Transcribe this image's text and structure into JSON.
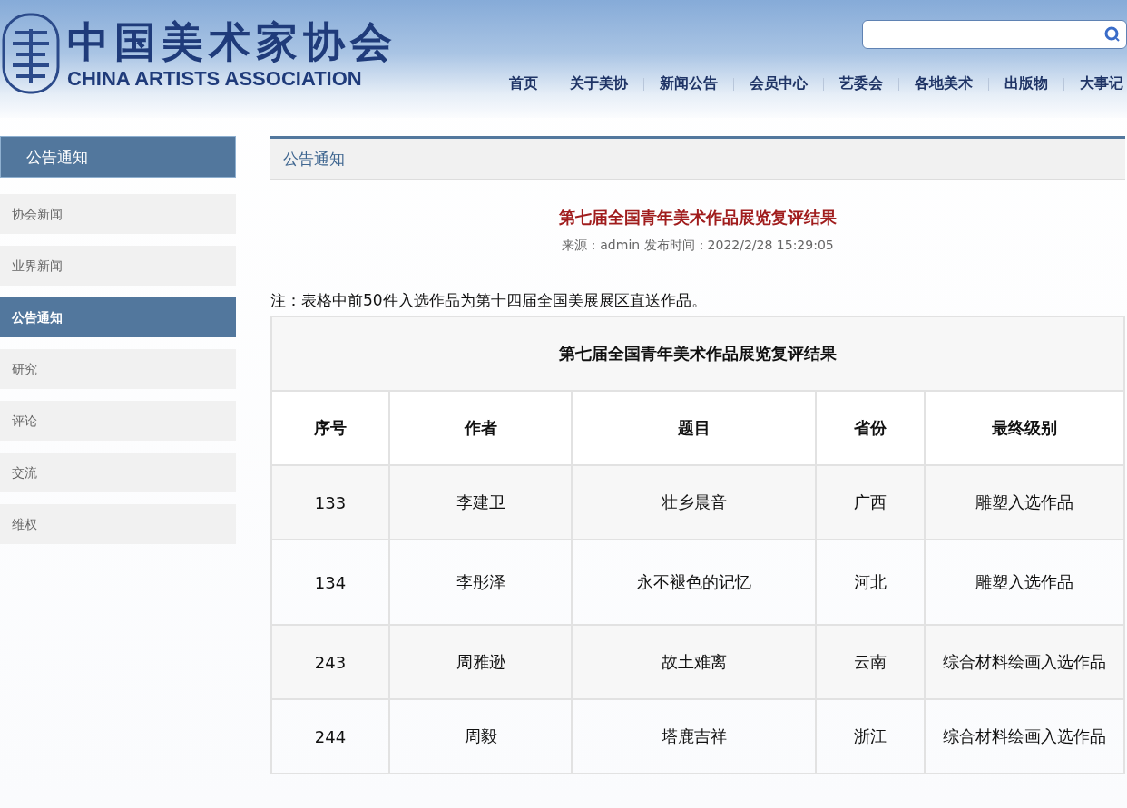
{
  "logo": {
    "title_zh": "中国美术家协会",
    "title_en": "CHINA ARTISTS ASSOCIATION"
  },
  "nav": [
    {
      "label": "首页"
    },
    {
      "label": "关于美协"
    },
    {
      "label": "新闻公告"
    },
    {
      "label": "会员中心"
    },
    {
      "label": "艺委会"
    },
    {
      "label": "各地美术"
    },
    {
      "label": "出版物"
    },
    {
      "label": "大事记"
    }
  ],
  "sidebar": {
    "title": "公告通知",
    "items": [
      {
        "label": "协会新闻",
        "selected": false
      },
      {
        "label": "业界新闻",
        "selected": false
      },
      {
        "label": "公告通知",
        "selected": true
      },
      {
        "label": "研究",
        "selected": false
      },
      {
        "label": "评论",
        "selected": false
      },
      {
        "label": "交流",
        "selected": false
      },
      {
        "label": "维权",
        "selected": false
      }
    ]
  },
  "content": {
    "section_title": "公告通知",
    "article_title": "第七届全国青年美术作品展览复评结果",
    "meta": "来源：admin 发布时间：2022/2/28 15:29:05",
    "note": "注：表格中前50件入选作品为第十四届全国美展展区直送作品。"
  },
  "table": {
    "caption": "第七届全国青年美术作品展览复评结果",
    "columns": [
      "序号",
      "作者",
      "题目",
      "省份",
      "最终级别"
    ],
    "rows": [
      [
        "133",
        "李建卫",
        "壮乡晨音",
        "广西",
        "雕塑入选作品"
      ],
      [
        "134",
        "李彤泽",
        "永不褪色的记忆",
        "河北",
        "雕塑入选作品"
      ],
      [
        "243",
        "周雅逊",
        "故土难离",
        "云南",
        "综合材料绘画入选作品"
      ],
      [
        "244",
        "周毅",
        "塔鹿吉祥",
        "浙江",
        "综合材料绘画入选作品"
      ]
    ]
  }
}
